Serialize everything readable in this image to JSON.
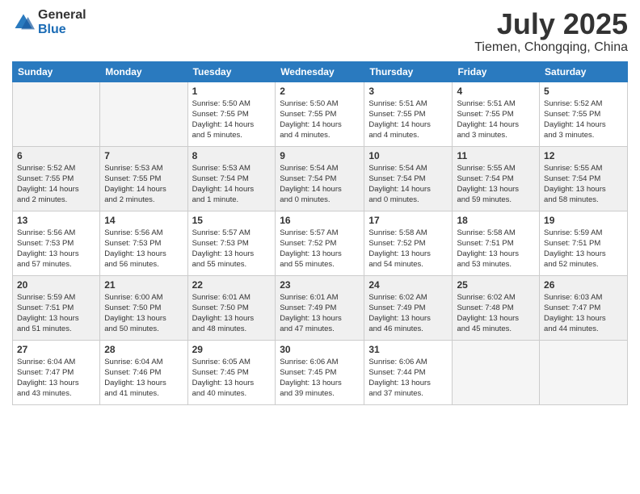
{
  "logo": {
    "general": "General",
    "blue": "Blue"
  },
  "header": {
    "month": "July 2025",
    "location": "Tiemen, Chongqing, China"
  },
  "weekdays": [
    "Sunday",
    "Monday",
    "Tuesday",
    "Wednesday",
    "Thursday",
    "Friday",
    "Saturday"
  ],
  "weeks": [
    [
      {
        "day": "",
        "info": ""
      },
      {
        "day": "",
        "info": ""
      },
      {
        "day": "1",
        "info": "Sunrise: 5:50 AM\nSunset: 7:55 PM\nDaylight: 14 hours\nand 5 minutes."
      },
      {
        "day": "2",
        "info": "Sunrise: 5:50 AM\nSunset: 7:55 PM\nDaylight: 14 hours\nand 4 minutes."
      },
      {
        "day": "3",
        "info": "Sunrise: 5:51 AM\nSunset: 7:55 PM\nDaylight: 14 hours\nand 4 minutes."
      },
      {
        "day": "4",
        "info": "Sunrise: 5:51 AM\nSunset: 7:55 PM\nDaylight: 14 hours\nand 3 minutes."
      },
      {
        "day": "5",
        "info": "Sunrise: 5:52 AM\nSunset: 7:55 PM\nDaylight: 14 hours\nand 3 minutes."
      }
    ],
    [
      {
        "day": "6",
        "info": "Sunrise: 5:52 AM\nSunset: 7:55 PM\nDaylight: 14 hours\nand 2 minutes."
      },
      {
        "day": "7",
        "info": "Sunrise: 5:53 AM\nSunset: 7:55 PM\nDaylight: 14 hours\nand 2 minutes."
      },
      {
        "day": "8",
        "info": "Sunrise: 5:53 AM\nSunset: 7:54 PM\nDaylight: 14 hours\nand 1 minute."
      },
      {
        "day": "9",
        "info": "Sunrise: 5:54 AM\nSunset: 7:54 PM\nDaylight: 14 hours\nand 0 minutes."
      },
      {
        "day": "10",
        "info": "Sunrise: 5:54 AM\nSunset: 7:54 PM\nDaylight: 14 hours\nand 0 minutes."
      },
      {
        "day": "11",
        "info": "Sunrise: 5:55 AM\nSunset: 7:54 PM\nDaylight: 13 hours\nand 59 minutes."
      },
      {
        "day": "12",
        "info": "Sunrise: 5:55 AM\nSunset: 7:54 PM\nDaylight: 13 hours\nand 58 minutes."
      }
    ],
    [
      {
        "day": "13",
        "info": "Sunrise: 5:56 AM\nSunset: 7:53 PM\nDaylight: 13 hours\nand 57 minutes."
      },
      {
        "day": "14",
        "info": "Sunrise: 5:56 AM\nSunset: 7:53 PM\nDaylight: 13 hours\nand 56 minutes."
      },
      {
        "day": "15",
        "info": "Sunrise: 5:57 AM\nSunset: 7:53 PM\nDaylight: 13 hours\nand 55 minutes."
      },
      {
        "day": "16",
        "info": "Sunrise: 5:57 AM\nSunset: 7:52 PM\nDaylight: 13 hours\nand 55 minutes."
      },
      {
        "day": "17",
        "info": "Sunrise: 5:58 AM\nSunset: 7:52 PM\nDaylight: 13 hours\nand 54 minutes."
      },
      {
        "day": "18",
        "info": "Sunrise: 5:58 AM\nSunset: 7:51 PM\nDaylight: 13 hours\nand 53 minutes."
      },
      {
        "day": "19",
        "info": "Sunrise: 5:59 AM\nSunset: 7:51 PM\nDaylight: 13 hours\nand 52 minutes."
      }
    ],
    [
      {
        "day": "20",
        "info": "Sunrise: 5:59 AM\nSunset: 7:51 PM\nDaylight: 13 hours\nand 51 minutes."
      },
      {
        "day": "21",
        "info": "Sunrise: 6:00 AM\nSunset: 7:50 PM\nDaylight: 13 hours\nand 50 minutes."
      },
      {
        "day": "22",
        "info": "Sunrise: 6:01 AM\nSunset: 7:50 PM\nDaylight: 13 hours\nand 48 minutes."
      },
      {
        "day": "23",
        "info": "Sunrise: 6:01 AM\nSunset: 7:49 PM\nDaylight: 13 hours\nand 47 minutes."
      },
      {
        "day": "24",
        "info": "Sunrise: 6:02 AM\nSunset: 7:49 PM\nDaylight: 13 hours\nand 46 minutes."
      },
      {
        "day": "25",
        "info": "Sunrise: 6:02 AM\nSunset: 7:48 PM\nDaylight: 13 hours\nand 45 minutes."
      },
      {
        "day": "26",
        "info": "Sunrise: 6:03 AM\nSunset: 7:47 PM\nDaylight: 13 hours\nand 44 minutes."
      }
    ],
    [
      {
        "day": "27",
        "info": "Sunrise: 6:04 AM\nSunset: 7:47 PM\nDaylight: 13 hours\nand 43 minutes."
      },
      {
        "day": "28",
        "info": "Sunrise: 6:04 AM\nSunset: 7:46 PM\nDaylight: 13 hours\nand 41 minutes."
      },
      {
        "day": "29",
        "info": "Sunrise: 6:05 AM\nSunset: 7:45 PM\nDaylight: 13 hours\nand 40 minutes."
      },
      {
        "day": "30",
        "info": "Sunrise: 6:06 AM\nSunset: 7:45 PM\nDaylight: 13 hours\nand 39 minutes."
      },
      {
        "day": "31",
        "info": "Sunrise: 6:06 AM\nSunset: 7:44 PM\nDaylight: 13 hours\nand 37 minutes."
      },
      {
        "day": "",
        "info": ""
      },
      {
        "day": "",
        "info": ""
      }
    ]
  ]
}
